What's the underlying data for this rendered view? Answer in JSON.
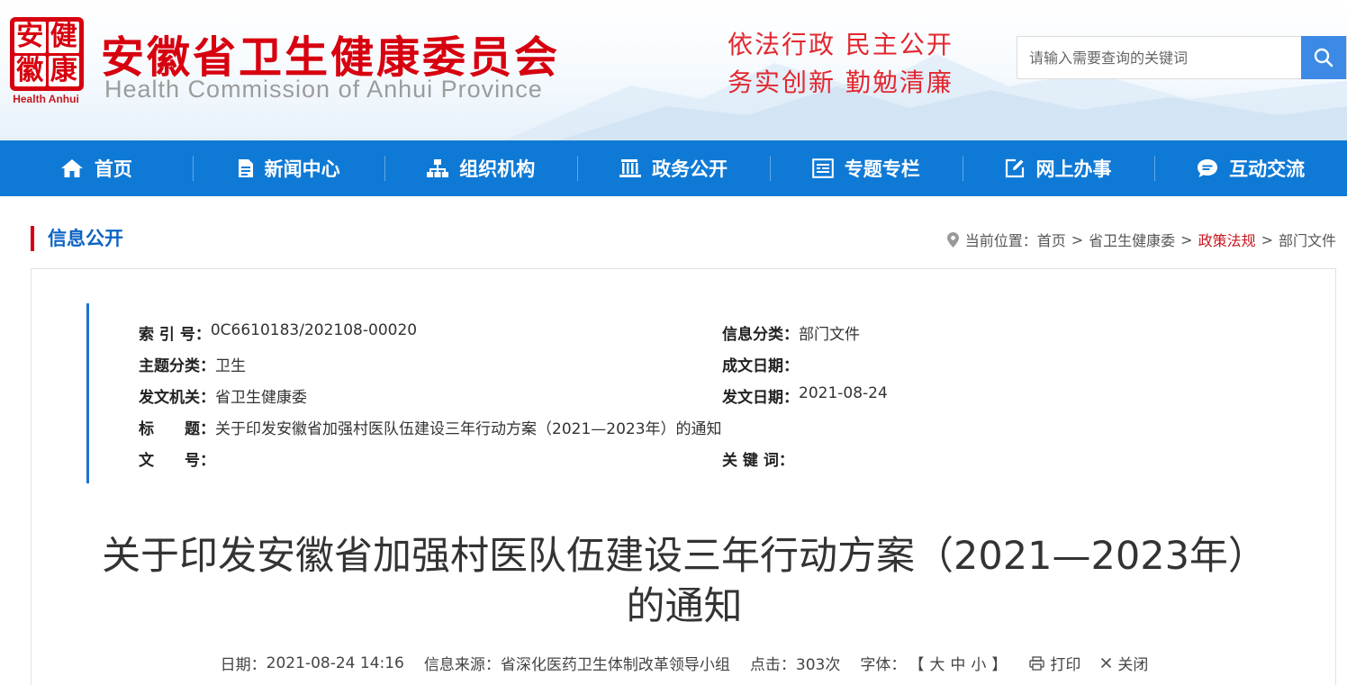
{
  "header": {
    "logo_chars": [
      "健",
      "安",
      "徽",
      "康"
    ],
    "logo_en": "Health Anhui",
    "site_name_cn": "安徽省卫生健康委员会",
    "site_name_en": "Health Commission of Anhui Province",
    "slogan_line1": "依法行政  民主公开",
    "slogan_line2": "务实创新  勤勉清廉",
    "search": {
      "placeholder": "请输入需要查询的关键词",
      "value": ""
    }
  },
  "nav": [
    {
      "label": "首页",
      "icon": "home-icon"
    },
    {
      "label": "新闻中心",
      "icon": "document-icon"
    },
    {
      "label": "组织机构",
      "icon": "org-chart-icon"
    },
    {
      "label": "政务公开",
      "icon": "building-icon"
    },
    {
      "label": "专题专栏",
      "icon": "list-box-icon"
    },
    {
      "label": "网上办事",
      "icon": "edit-icon"
    },
    {
      "label": "互动交流",
      "icon": "chat-icon"
    }
  ],
  "section_title": "信息公开",
  "breadcrumb": {
    "prefix": "当前位置：",
    "items": [
      "首页",
      "省卫生健康委",
      "政策法规",
      "部门文件"
    ],
    "separator": ">"
  },
  "meta": {
    "index_label": "索 引 号：",
    "index_value": "0C6610183/202108-00020",
    "category_label": "信息分类：",
    "category_value": "部门文件",
    "topic_label": "主题分类：",
    "topic_value": "卫生",
    "created_label": "成文日期：",
    "created_value": "",
    "issuer_label": "发文机关：",
    "issuer_value": "省卫生健康委",
    "issued_label": "发文日期：",
    "issued_value": "2021-08-24",
    "title_label": "标　　题：",
    "title_value": "关于印发安徽省加强村医队伍建设三年行动方案（2021—2023年）的通知",
    "docno_label": "文　　号：",
    "docno_value": "",
    "keywords_label": "关 键 词：",
    "keywords_value": ""
  },
  "article": {
    "title": "关于印发安徽省加强村医队伍建设三年行动方案（2021—2023年）的通知",
    "date_label": "日期：",
    "date_value": "2021-08-24 14:16",
    "source_label": "信息来源：",
    "source_value": "省深化医药卫生体制改革领导小组",
    "hits_label": "点击：",
    "hits_value": "303次",
    "font_label": "字体：",
    "font_open": "【",
    "font_large": "大",
    "font_medium": "中",
    "font_small": "小",
    "font_close": "】",
    "print_label": "打印",
    "close_label": "关闭"
  },
  "colors": {
    "nav_bg": "#0f7ad6",
    "brand_red": "#d7000f",
    "slogan_red": "#e3272f",
    "search_btn": "#3c8ae6"
  }
}
